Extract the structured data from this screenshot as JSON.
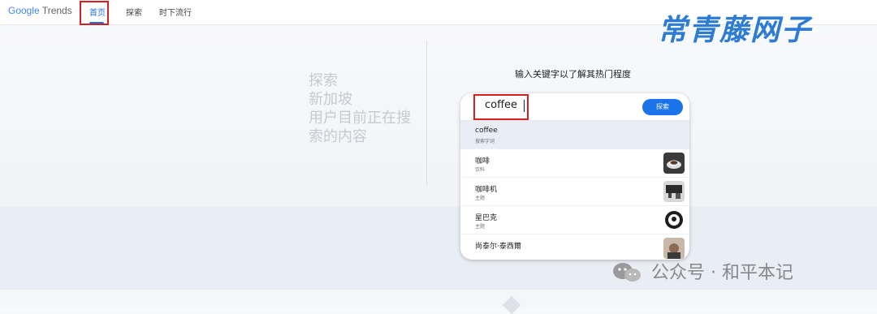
{
  "brand": {
    "google": "Google",
    "product": "Trends"
  },
  "nav": {
    "home": "首页",
    "explore": "探索",
    "trending": "时下流行"
  },
  "watermark_top": "常青藤网子",
  "left_text": [
    "探索",
    "新加坡",
    "用户目前正在搜",
    "索的内容"
  ],
  "search": {
    "heading": "输入关键字以了解其热门程度",
    "value": "coffee",
    "button": "探索"
  },
  "suggestions": [
    {
      "title": "coffee",
      "subtitle": "搜索字词",
      "thumb": "none"
    },
    {
      "title": "咖啡",
      "subtitle": "饮料",
      "thumb": "coffee-cup-image"
    },
    {
      "title": "咖啡机",
      "subtitle": "主题",
      "thumb": "coffee-machine-image"
    },
    {
      "title": "星巴克",
      "subtitle": "主题",
      "thumb": "starbucks-logo-image"
    },
    {
      "title": "尚泰尔·泰西爾",
      "subtitle": "",
      "thumb": "person-photo-image"
    }
  ],
  "watermark_bottom": "公众号 · 和平本记",
  "colors": {
    "accent": "#1a73e8",
    "highlight_box": "#d32020",
    "watermark_blue": "#2d7bd3"
  }
}
